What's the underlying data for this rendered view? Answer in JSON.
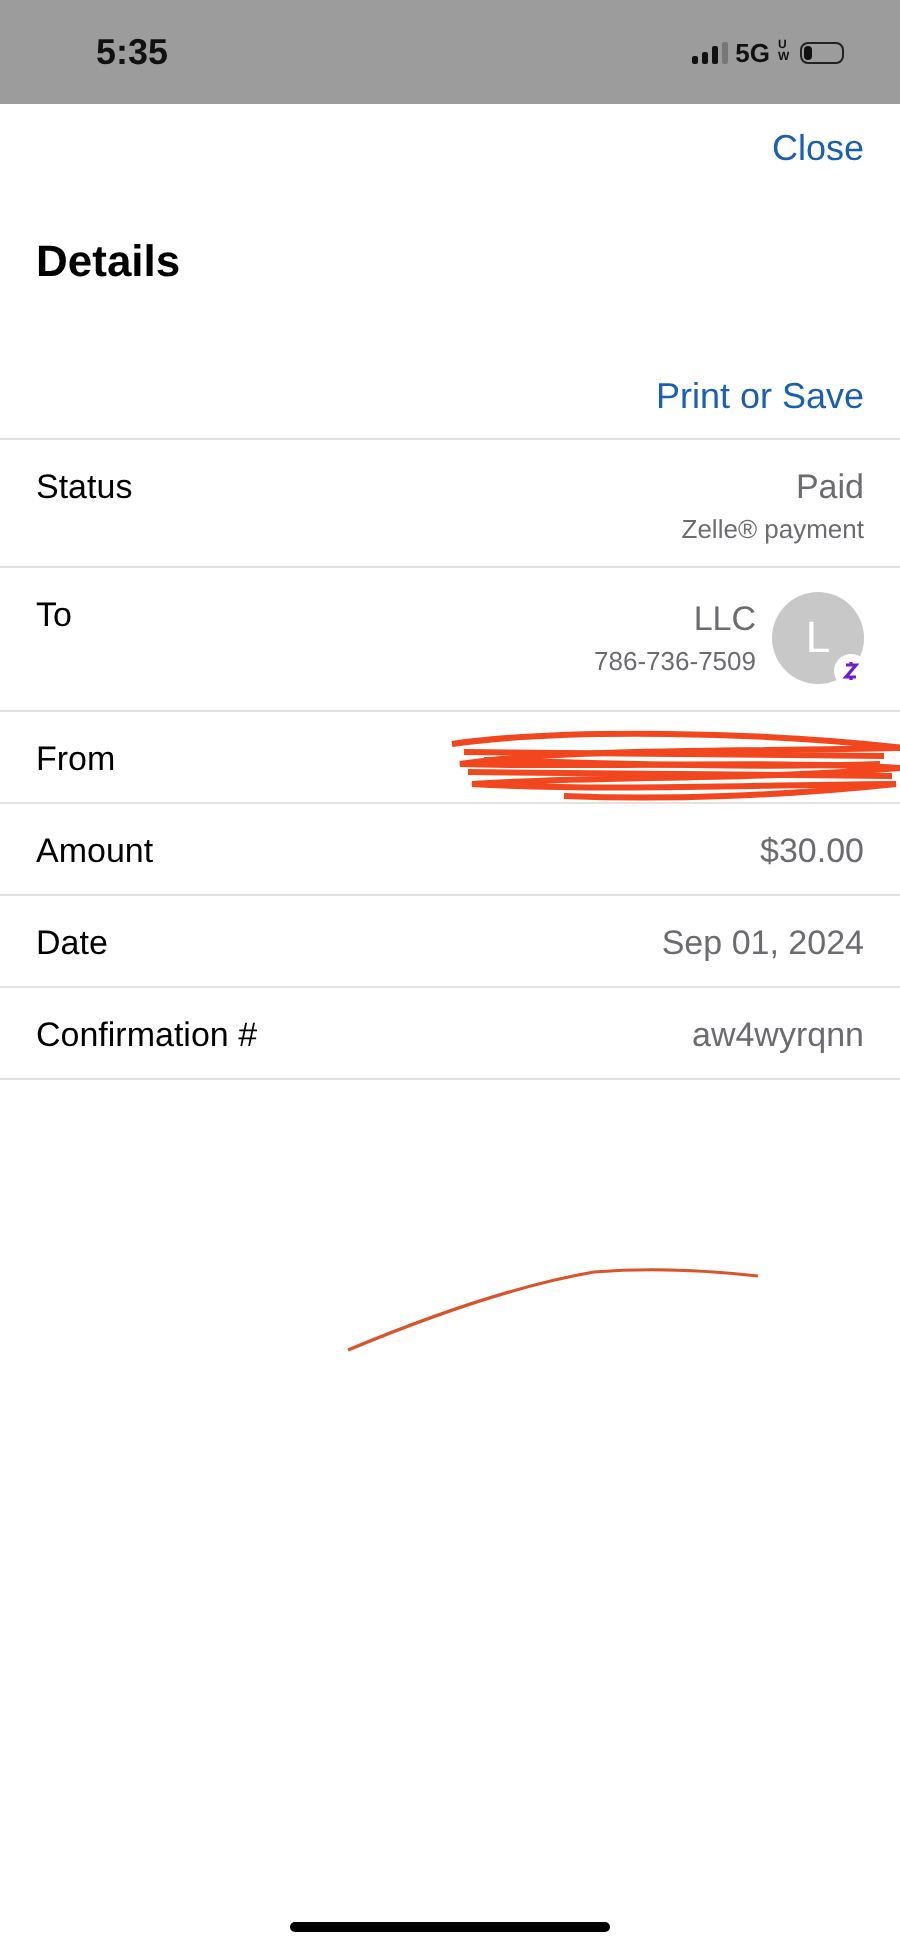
{
  "status_bar": {
    "time": "5:35",
    "network": "5G",
    "network_badge": "UW"
  },
  "header": {
    "close": "Close",
    "title": "Details",
    "print": "Print or Save"
  },
  "rows": [
    {
      "kind": "status",
      "label": "Status",
      "value": "Paid",
      "subvalue": "Zelle® payment"
    },
    {
      "kind": "contact",
      "label": "To",
      "value": "LLC",
      "subvalue": "786-736-7509",
      "avatar_letter": "L"
    },
    {
      "kind": "redacted",
      "label": "From"
    },
    {
      "kind": "plain",
      "label": "Amount",
      "value": "$30.00"
    },
    {
      "kind": "plain",
      "label": "Date",
      "value": "Sep 01, 2024"
    },
    {
      "kind": "plain",
      "label": "Confirmation #",
      "value": "aw4wyrqnn"
    }
  ]
}
